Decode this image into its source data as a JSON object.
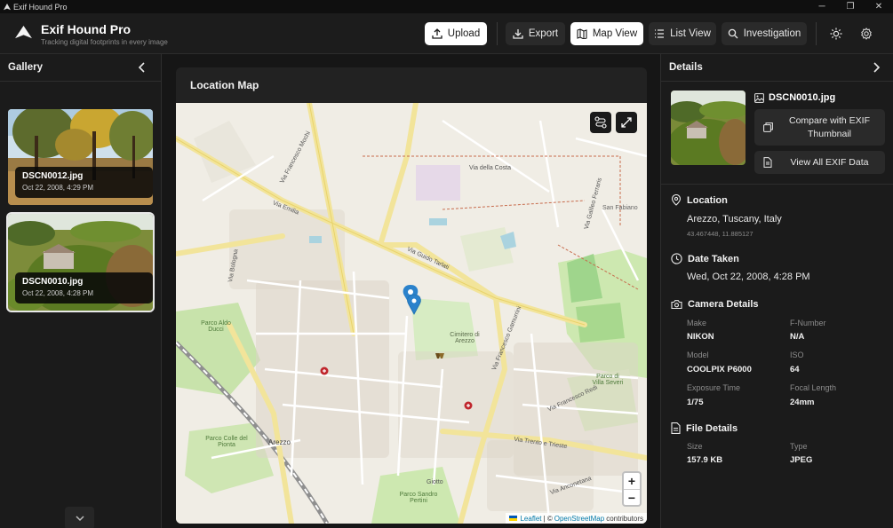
{
  "window": {
    "title": "Exif Hound Pro"
  },
  "header": {
    "title": "Exif Hound Pro",
    "subtitle": "Tracking digital footprints in every image",
    "buttons": {
      "upload": "Upload",
      "export": "Export",
      "map_view": "Map View",
      "list_view": "List View",
      "investigation": "Investigation"
    }
  },
  "gallery": {
    "title": "Gallery",
    "items": [
      {
        "filename": "DSCN0012.jpg",
        "date": "Oct 22, 2008, 4:29 PM"
      },
      {
        "filename": "DSCN0010.jpg",
        "date": "Oct 22, 2008, 4:28 PM"
      }
    ]
  },
  "map": {
    "title": "Location Map",
    "attribution": {
      "leaflet": "Leaflet",
      "separator": "| ©",
      "osm": "OpenStreetMap",
      "suffix": "contributors"
    },
    "zoom_in": "+",
    "zoom_out": "−",
    "labels": {
      "via_mochi": "Via Francesco Mochi",
      "via_tarlati": "Via Guido Tarlati",
      "via_gamurrini": "Via Francesco Gamurrini",
      "via_trento": "Via Trento e Trieste",
      "via_emilia": "Via Emilia",
      "via_bologna": "Via Bologna",
      "via_ferraris": "Via Galileo Ferraris",
      "cimitero": "Cimitero di Arezzo",
      "parco_aldo": "Parco Aldo Ducci",
      "parco_colle": "Parco Colle del Pionta",
      "arezzo": "Arezzo",
      "san_fabiano": "San Fabiano",
      "villa_severi": "Parco di Villa Severi",
      "parco_pertini": "Parco Sandro Pertini",
      "via_anconetana": "Via Anconetana",
      "giotto": "Giotto",
      "via_francesco_redi": "Via Francesco Redi",
      "via_della_costa": "Via della Costa"
    }
  },
  "details": {
    "title": "Details",
    "filename": "DSCN0010.jpg",
    "compare_button": "Compare with EXIF Thumbnail",
    "view_all_button": "View All EXIF Data",
    "location": {
      "heading": "Location",
      "place": "Arezzo, Tuscany, Italy",
      "coords": "43.467448, 11.885127"
    },
    "date": {
      "heading": "Date Taken",
      "value": "Wed, Oct 22, 2008, 4:28 PM"
    },
    "camera": {
      "heading": "Camera Details",
      "make_label": "Make",
      "make": "NIKON",
      "fnumber_label": "F-Number",
      "fnumber": "N/A",
      "model_label": "Model",
      "model": "COOLPIX P6000",
      "iso_label": "ISO",
      "iso": "64",
      "exposure_label": "Exposure Time",
      "exposure": "1/75",
      "focal_label": "Focal Length",
      "focal": "24mm"
    },
    "file": {
      "heading": "File Details",
      "size_label": "Size",
      "size": "157.9 KB",
      "type_label": "Type",
      "type": "JPEG"
    }
  },
  "colors": {
    "accent": "#2b82cb",
    "background": "#161616",
    "panel": "#1b1b1b",
    "button": "#2a2a2a"
  }
}
